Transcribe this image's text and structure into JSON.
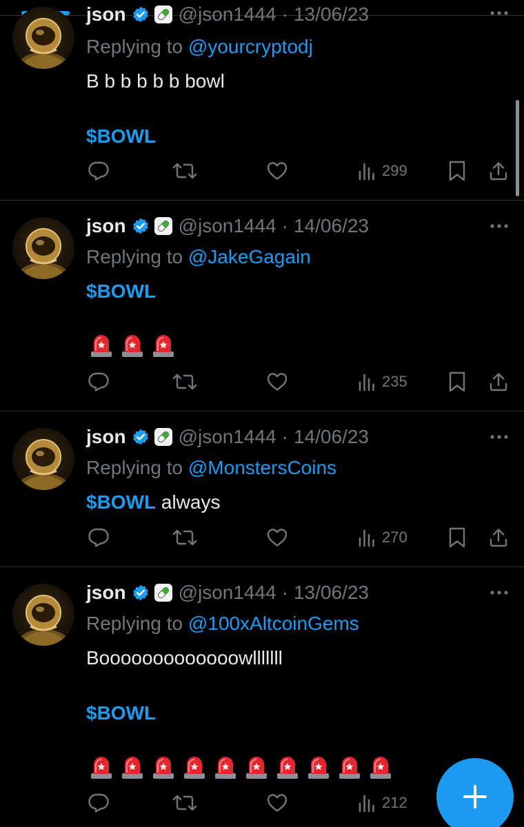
{
  "app": {
    "accent_color": "#1d9bf0",
    "background_color": "#000000"
  },
  "tweets": [
    {
      "author_name": "json",
      "handle": "@json1444",
      "date": "13/06/23",
      "replying_prefix": "Replying to",
      "replying_to": "@yourcryptodj",
      "text_line_1": "B b b b b b bowl",
      "cashtag": "$BOWL",
      "views": "299"
    },
    {
      "author_name": "json",
      "handle": "@json1444",
      "date": "14/06/23",
      "replying_prefix": "Replying to",
      "replying_to": "@JakeGagain",
      "cashtag": "$BOWL",
      "emoji": "police-light",
      "emoji_count": 3,
      "views": "235"
    },
    {
      "author_name": "json",
      "handle": "@json1444",
      "date": "14/06/23",
      "replying_prefix": "Replying to",
      "replying_to": "@MonstersCoins",
      "cashtag": "$BOWL",
      "text_after": " always",
      "views": "270"
    },
    {
      "author_name": "json",
      "handle": "@json1444",
      "date": "13/06/23",
      "replying_prefix": "Replying to",
      "replying_to": "@100xAltcoinGems",
      "text_line_1": "Booooooooooooowlllllll",
      "cashtag": "$BOWL",
      "emoji": "police-light",
      "emoji_count": 10,
      "views": "212"
    }
  ],
  "icons": [
    "verified-badge-icon",
    "pill-emoji-icon",
    "more-icon",
    "reply-icon",
    "retweet-icon",
    "like-icon",
    "views-icon",
    "bookmark-icon",
    "share-icon",
    "police-light-emoji-icon",
    "plus-icon"
  ],
  "fab": {
    "icon": "plus-icon"
  }
}
